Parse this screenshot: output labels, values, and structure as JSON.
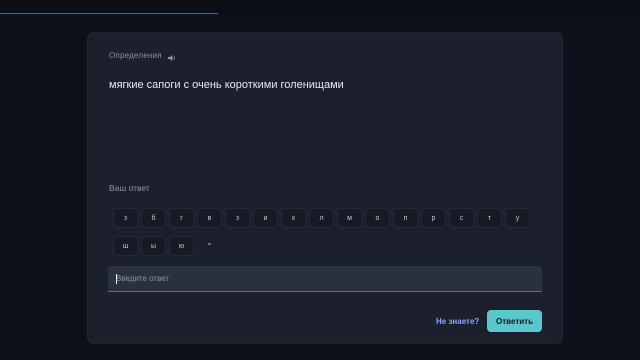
{
  "progress": {
    "fraction": 0.34,
    "color": "#4b63c7"
  },
  "card": {
    "term_label": "Определения",
    "speaker_icon": "speaker-icon",
    "definition": "мягкие сапоги с очень короткими голенищами"
  },
  "answer": {
    "label": "Ваш ответ",
    "input_placeholder": "Введите ответ",
    "input_value": ""
  },
  "keyboard": {
    "row1": [
      "з",
      "б",
      "г",
      "в",
      "з",
      "и",
      "к",
      "л",
      "м",
      "о",
      "п",
      "р",
      "с",
      "т",
      "у"
    ],
    "row2": [
      "ш",
      "ы",
      "ю"
    ],
    "shift_glyph": "⌃"
  },
  "actions": {
    "dont_know": "Не знаете?",
    "submit": "Ответить",
    "submit_color": "#5ac7cf"
  }
}
